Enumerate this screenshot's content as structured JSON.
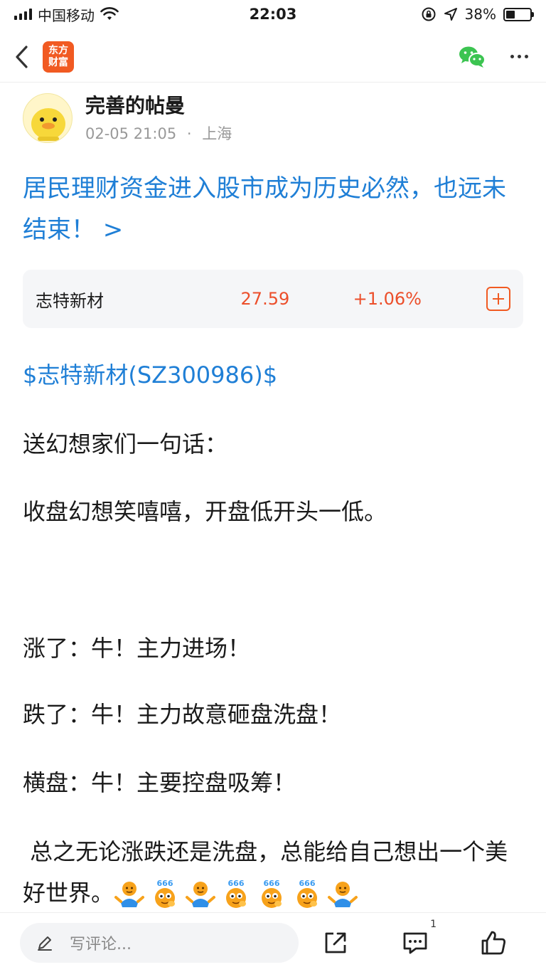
{
  "status_bar": {
    "carrier": "中国移动",
    "time": "22:03",
    "battery_percent": "38%",
    "battery_level": 0.38
  },
  "nav": {
    "logo_line1": "东方",
    "logo_line2": "财富",
    "icons": [
      "back-icon",
      "wechat-share-icon",
      "more-icon"
    ]
  },
  "author": {
    "name": "完善的帖曼",
    "date": "02-05 21:05",
    "separator": "·",
    "location": "上海"
  },
  "headline": "居民理财资金进入股市成为历史必然，也远未结束！ >",
  "stock_card": {
    "name": "志特新材",
    "price": "27.59",
    "change": "+1.06%",
    "price_color": "#ec4f2b"
  },
  "post": {
    "stock_tag": "$志特新材(SZ300986)$",
    "line1": "送幻想家们一句话：",
    "line2": "收盘幻想笑嘻嘻，开盘低开头一低。",
    "line3": "涨了：牛！主力进场！",
    "line4": "跌了：牛！主力故意砸盘洗盘！",
    "line5": "横盘：牛！主要控盘吸筹！",
    "line6": " 总之无论涨跌还是洗盘，总能给自己想出一个美好世界。",
    "emojis": [
      "shrug-emoji",
      "666-emoji",
      "shrug-emoji",
      "666-emoji",
      "666-emoji",
      "666-emoji",
      "shrug-emoji"
    ]
  },
  "bottom_bar": {
    "comment_placeholder": "写评论...",
    "comment_count": "1"
  },
  "colors": {
    "accent_blue": "#1f7fd6",
    "brand_orange": "#f15a22",
    "up_red": "#ec4f2b"
  }
}
